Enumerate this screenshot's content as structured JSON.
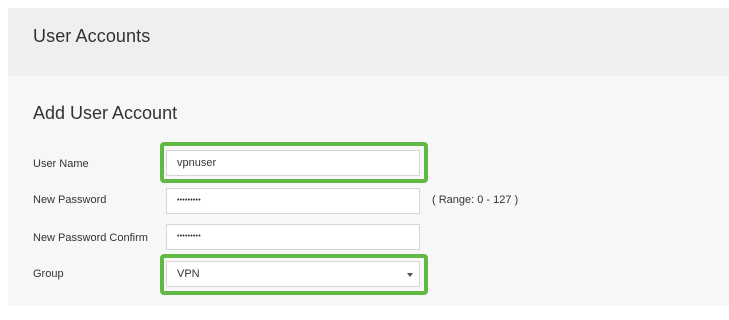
{
  "header": {
    "title": "User Accounts"
  },
  "form": {
    "title": "Add User Account",
    "username": {
      "label": "User Name",
      "value": "vpnuser"
    },
    "new_password": {
      "label": "New Password",
      "value_masked": "•••••••••",
      "hint": "( Range: 0 - 127 )"
    },
    "confirm_password": {
      "label": "New Password Confirm",
      "value_masked": "•••••••••"
    },
    "group": {
      "label": "Group",
      "selected": "VPN"
    }
  },
  "colors": {
    "highlight": "#62b844",
    "header_bg": "#efefef",
    "body_bg": "#f7f7f7"
  },
  "icons": {
    "group_select": "chevron-down-icon"
  }
}
